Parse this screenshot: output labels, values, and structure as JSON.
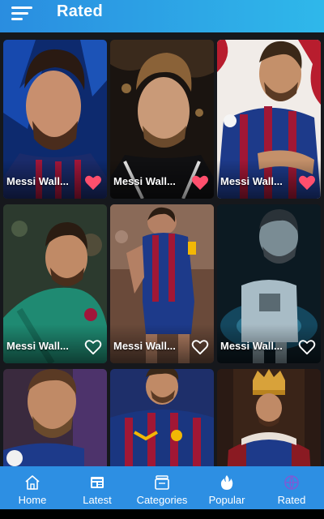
{
  "app_bar": {
    "title": "Rated",
    "menu_icon": "hamburger-menu-icon"
  },
  "theme": {
    "accent": "#2d8fe3",
    "liked": "#ff4f6d",
    "background": "#14161a"
  },
  "wallpapers": [
    {
      "title": "Messi Wall...",
      "liked": true
    },
    {
      "title": "Messi Wall...",
      "liked": true
    },
    {
      "title": "Messi Wall...",
      "liked": true
    },
    {
      "title": "Messi Wall...",
      "liked": false
    },
    {
      "title": "Messi Wall...",
      "liked": false
    },
    {
      "title": "Messi Wall...",
      "liked": false
    },
    {
      "title": "",
      "liked": false
    },
    {
      "title": "",
      "liked": false
    },
    {
      "title": "",
      "liked": false
    }
  ],
  "bottom_nav": [
    {
      "label": "Home",
      "icon": "home-icon",
      "active": false
    },
    {
      "label": "Latest",
      "icon": "latest-icon",
      "active": false
    },
    {
      "label": "Categories",
      "icon": "categories-icon",
      "active": false
    },
    {
      "label": "Popular",
      "icon": "flame-icon",
      "active": false
    },
    {
      "label": "Rated",
      "icon": "rated-icon",
      "active": true
    }
  ]
}
